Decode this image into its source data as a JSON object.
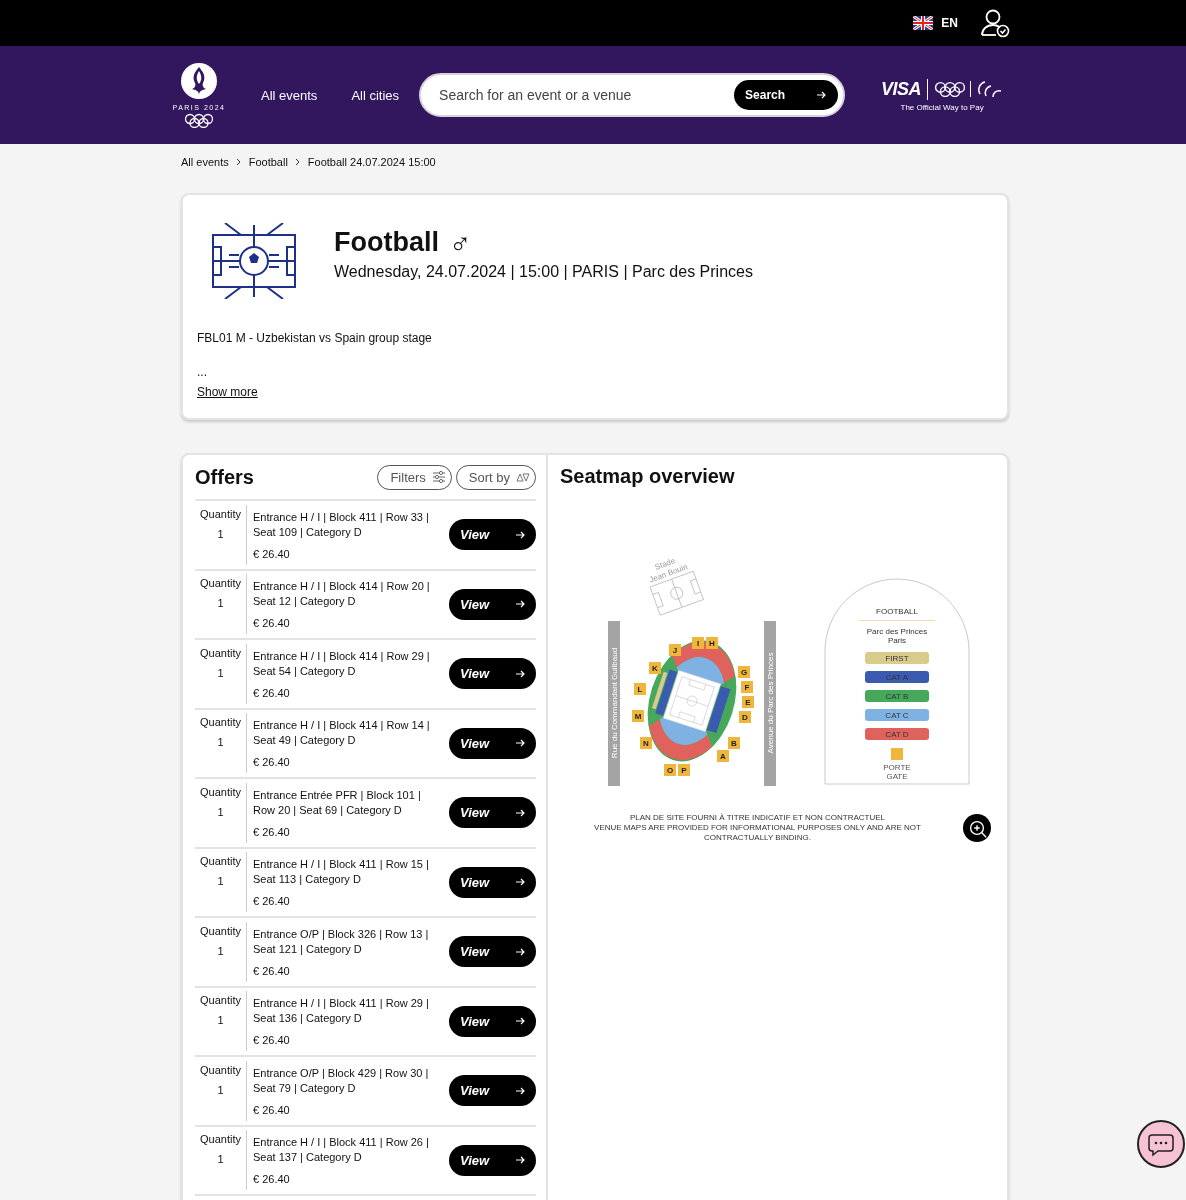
{
  "top_bar": {
    "language": "EN"
  },
  "nav": {
    "logo_text": "PARIS 2024",
    "links": [
      "All events",
      "All cities"
    ],
    "search": {
      "placeholder": "Search for an event or a venue",
      "button": "Search"
    },
    "sponsor": {
      "brand": "VISA",
      "tagline": "The Official Way to Pay"
    }
  },
  "breadcrumb": [
    "All events",
    "Football",
    "Football 24.07.2024 15:00"
  ],
  "event": {
    "title": "Football",
    "gender_symbol": "♂",
    "details": "Wednesday, 24.07.2024 | 15:00 | PARIS | Parc des Princes",
    "description": "FBL01 M - Uzbekistan vs Spain group stage",
    "ellipsis": "...",
    "show_more": "Show more"
  },
  "offers": {
    "title": "Offers",
    "filters": "Filters",
    "sort": "Sort by",
    "items": [
      {
        "quantity_label": "Quantity",
        "quantity": "1",
        "description": "Entrance H / I | Block 411 | Row 33 | Seat 109 | Category D",
        "price": "€ 26.40",
        "button": "View"
      },
      {
        "quantity_label": "Quantity",
        "quantity": "1",
        "description": "Entrance H / I | Block 414 | Row 20 | Seat 12 | Category D",
        "price": "€ 26.40",
        "button": "View"
      },
      {
        "quantity_label": "Quantity",
        "quantity": "1",
        "description": "Entrance H / I | Block 414 | Row 29 | Seat 54 | Category D",
        "price": "€ 26.40",
        "button": "View"
      },
      {
        "quantity_label": "Quantity",
        "quantity": "1",
        "description": "Entrance H / I | Block 414 | Row 14 | Seat 49 | Category D",
        "price": "€ 26.40",
        "button": "View"
      },
      {
        "quantity_label": "Quantity",
        "quantity": "1",
        "description": "Entrance Entrée PFR | Block 101 | Row 20 | Seat 69 | Category D",
        "price": "€ 26.40",
        "button": "View"
      },
      {
        "quantity_label": "Quantity",
        "quantity": "1",
        "description": "Entrance H / I | Block 411 | Row 15 | Seat 113 | Category D",
        "price": "€ 26.40",
        "button": "View"
      },
      {
        "quantity_label": "Quantity",
        "quantity": "1",
        "description": "Entrance O/P | Block 326 | Row 13 | Seat 121 | Category D",
        "price": "€ 26.40",
        "button": "View"
      },
      {
        "quantity_label": "Quantity",
        "quantity": "1",
        "description": "Entrance H / I | Block 411 | Row 29 | Seat 136 | Category D",
        "price": "€ 26.40",
        "button": "View"
      },
      {
        "quantity_label": "Quantity",
        "quantity": "1",
        "description": "Entrance O/P | Block 429 | Row 30 | Seat 79 | Category D",
        "price": "€ 26.40",
        "button": "View"
      },
      {
        "quantity_label": "Quantity",
        "quantity": "1",
        "description": "Entrance H / I | Block 411 | Row 26 | Seat 137 | Category D",
        "price": "€ 26.40",
        "button": "View"
      }
    ]
  },
  "seatmap": {
    "title": "Seatmap overview",
    "nearby_venue": [
      "Stade",
      "Jean Bouin"
    ],
    "streets": [
      "Rue du Commandant Guilbaud",
      "Avenue du Parc des Princes"
    ],
    "gates": [
      "I",
      "H",
      "J",
      "K",
      "G",
      "F",
      "L",
      "E",
      "M",
      "D",
      "N",
      "B",
      "A",
      "O",
      "P"
    ],
    "legend": {
      "title": "FOOTBALL",
      "venue": "Parc des Princes",
      "city": "Paris",
      "categories": [
        {
          "label": "FIRST",
          "color": "#d9cb8c"
        },
        {
          "label": "CAT A",
          "color": "#3b5bb0"
        },
        {
          "label": "CAT B",
          "color": "#45a85a"
        },
        {
          "label": "CAT C",
          "color": "#7fb2e3"
        },
        {
          "label": "CAT D",
          "color": "#e0625c"
        }
      ],
      "gate_fr": "PORTE",
      "gate_en": "GATE"
    },
    "disclaimer": [
      "PLAN DE SITE FOURNI À TITRE INDICATIF ET NON CONTRACTUEL",
      "VENUE MAPS ARE PROVIDED FOR INFORMATIONAL PURPOSES ONLY AND ARE NOT CONTRACTUALLY BINDING."
    ]
  }
}
